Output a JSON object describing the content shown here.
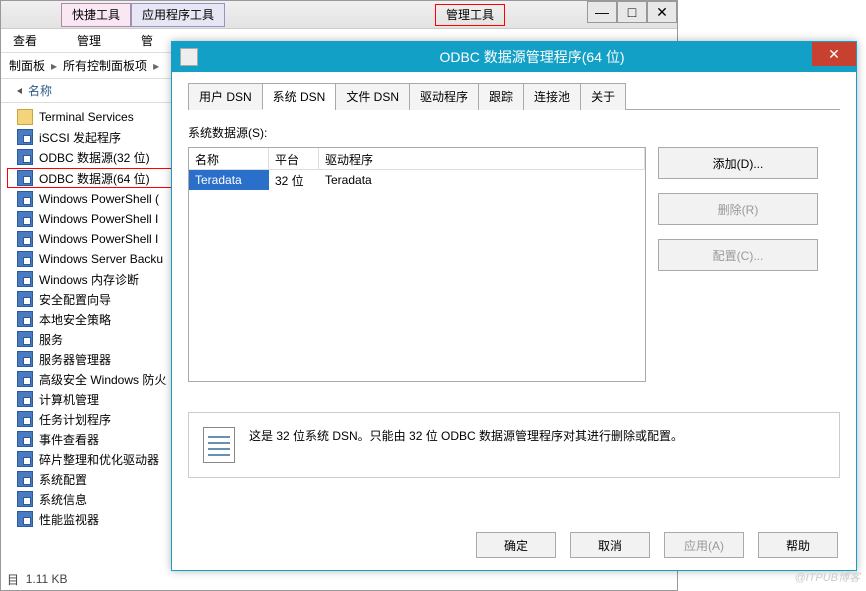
{
  "explorer": {
    "tab_quick": "快捷工具",
    "tab_app": "应用程序工具",
    "tab_mgmt": "管理工具",
    "menu_view": "查看",
    "menu_manage": "管理",
    "menu_mgr2": "管",
    "bc1": "制面板",
    "bc2": "所有控制面板项",
    "col_name": "名称",
    "items": [
      "Terminal Services",
      "iSCSI 发起程序",
      "ODBC 数据源(32 位)",
      "ODBC 数据源(64 位)",
      "Windows PowerShell (",
      "Windows PowerShell I",
      "Windows PowerShell I",
      "Windows Server Backu",
      "Windows 内存诊断",
      "安全配置向导",
      "本地安全策略",
      "服务",
      "服务器管理器",
      "高级安全 Windows 防火",
      "计算机管理",
      "任务计划程序",
      "事件查看器",
      "碎片整理和优化驱动器",
      "系统配置",
      "系统信息",
      "性能监视器"
    ],
    "status": "1.11 KB",
    "status_prefix": "目"
  },
  "odbc": {
    "title": "ODBC 数据源管理程序(64 位)",
    "tabs": [
      "用户 DSN",
      "系统 DSN",
      "文件 DSN",
      "驱动程序",
      "跟踪",
      "连接池",
      "关于"
    ],
    "active_tab": 1,
    "system_label": "系统数据源(S):",
    "cols": {
      "name": "名称",
      "platform": "平台",
      "driver": "驱动程序"
    },
    "row": {
      "name": "Teradata",
      "platform": "32 位",
      "driver": "Teradata"
    },
    "btn_add": "添加(D)...",
    "btn_del": "删除(R)",
    "btn_cfg": "配置(C)...",
    "info": "这是 32 位系统 DSN。只能由 32 位 ODBC 数据源管理程序对其进行删除或配置。",
    "btn_ok": "确定",
    "btn_cancel": "取消",
    "btn_apply": "应用(A)",
    "btn_help": "帮助"
  },
  "watermark": "@ITPUB博客"
}
